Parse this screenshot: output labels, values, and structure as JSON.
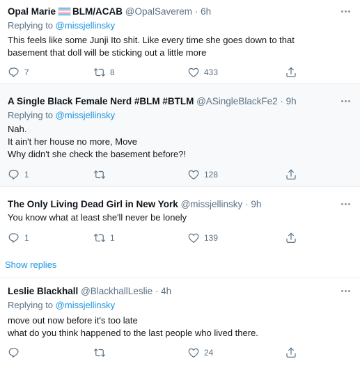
{
  "tweets": [
    {
      "name": "Opal Marie",
      "name_suffix": "BLM/ACAB",
      "handle": "@OpalSaverem",
      "separator": "·",
      "time": "6h",
      "replying_prefix": "Replying to",
      "replying_mention": "@missjellinsky",
      "lines": [
        "This feels like some Junji Ito shit. Like every time she goes down to that",
        "basement that doll will be sticking out a little more"
      ],
      "replies": "7",
      "retweets": "8",
      "likes": "433"
    },
    {
      "name": "A Single Black Female Nerd #BLM #BTLM",
      "handle": "@ASingleBlackFe2",
      "separator": "·",
      "time": "9h",
      "replying_prefix": "Replying to",
      "replying_mention": "@missjellinsky",
      "lines": [
        "Nah.",
        "It ain't her house no more, Move",
        "Why didn't she check the basement before?!"
      ],
      "replies": "1",
      "retweets": "",
      "likes": "128"
    },
    {
      "name": "The Only Living Dead Girl in New York",
      "handle": "@missjellinsky",
      "separator": "·",
      "time": "9h",
      "lines": [
        "You know what at least she'll never be lonely"
      ],
      "replies": "1",
      "retweets": "1",
      "likes": "139"
    },
    {
      "name": "Leslie Blackhall",
      "handle": "@BlackhallLeslie",
      "separator": "·",
      "time": "4h",
      "replying_prefix": "Replying to",
      "replying_mention": "@missjellinsky",
      "lines": [
        "move out now before it's too late",
        "what do you think happened to the last people who lived there."
      ],
      "replies": "",
      "retweets": "",
      "likes": "24"
    }
  ],
  "show_replies_label": "Show replies",
  "icons": {
    "reply": "reply-icon",
    "retweet": "retweet-icon",
    "like": "heart-icon",
    "share": "share-icon",
    "more": "more-icon",
    "flag": "transgender-flag-icon"
  },
  "colors": {
    "link": "#1b95e0",
    "secondary_text": "#5b7083",
    "shaded_background": "#f7f9fa",
    "divider": "#e6ecf0"
  }
}
